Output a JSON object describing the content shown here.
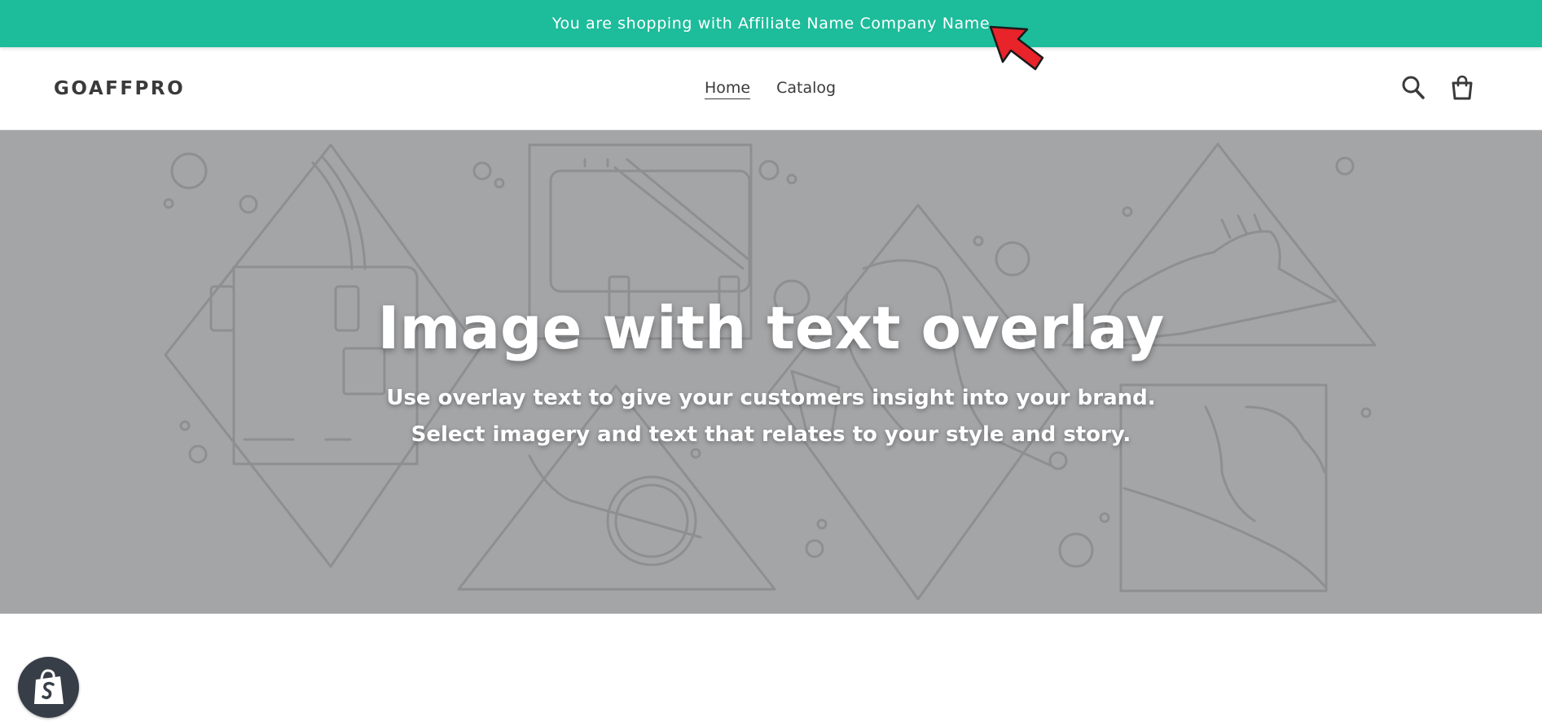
{
  "announcement": {
    "text": "You are shopping with Affiliate Name Company Name"
  },
  "header": {
    "logo": "GOAFFPRO",
    "nav": [
      {
        "label": "Home",
        "active": true
      },
      {
        "label": "Catalog",
        "active": false
      }
    ],
    "icons": {
      "search": "search-icon",
      "cart": "cart-icon"
    }
  },
  "hero": {
    "title": "Image with text overlay",
    "subtitle_line1": "Use overlay text to give your customers insight into your brand.",
    "subtitle_line2": "Select imagery and text that relates to your style and story."
  },
  "badge": {
    "icon": "shopify-bag-icon"
  },
  "colors": {
    "announcement_bg": "#1dbc9b",
    "hero_bg": "#a4a5a7",
    "text": "#3a3a3a",
    "badge_bg": "#383e47",
    "arrow": "#e8232a"
  }
}
